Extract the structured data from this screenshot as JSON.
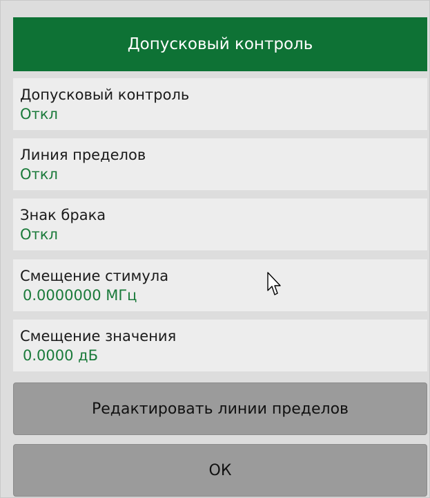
{
  "header": {
    "title": "Допусковый контроль"
  },
  "items": [
    {
      "label": "Допусковый контроль",
      "value": "Откл"
    },
    {
      "label": "Линия пределов",
      "value": "Откл"
    },
    {
      "label": "Знак брака",
      "value": "Откл"
    },
    {
      "label": "Смещение стимула",
      "value": "0.0000000 МГц"
    },
    {
      "label": "Смещение значения",
      "value": "0.0000 дБ"
    }
  ],
  "buttons": {
    "edit_limits": "Редактировать линии пределов",
    "ok": "ОК"
  },
  "colors": {
    "header_bg": "#0e7235",
    "value_text": "#1a7a3a",
    "button_bg": "#9b9b9b",
    "item_bg": "#ededed"
  },
  "icons": {
    "cursor": "mouse-pointer-icon"
  }
}
